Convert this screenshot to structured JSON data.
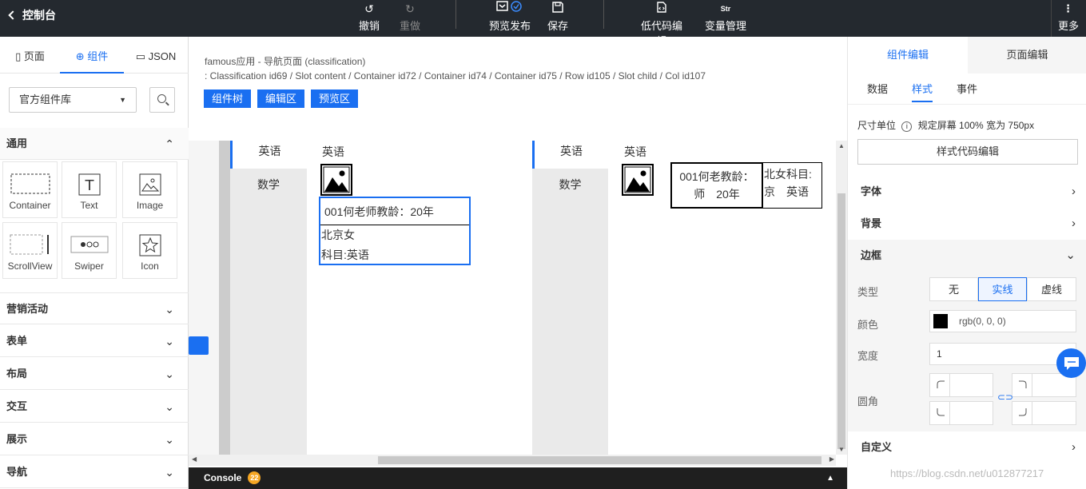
{
  "topbar": {
    "back_label": "控制台",
    "undo": "撤销",
    "redo": "重做",
    "preview": "预览发布",
    "save": "保存",
    "lowcode": "低代码编辑",
    "variables": "变量管理",
    "variables_icon_text": "Str",
    "more": "更多"
  },
  "left": {
    "tabs": [
      {
        "label": "页面"
      },
      {
        "label": "组件"
      },
      {
        "label": "JSON"
      }
    ],
    "library": "官方组件库",
    "general": "通用",
    "components": [
      {
        "label": "Container"
      },
      {
        "label": "Text"
      },
      {
        "label": "Image"
      },
      {
        "label": "ScrollView"
      },
      {
        "label": "Swiper"
      },
      {
        "label": "Icon"
      }
    ],
    "text_icon_glyph": "T",
    "sections": [
      {
        "label": "营销活动"
      },
      {
        "label": "表单"
      },
      {
        "label": "布局"
      },
      {
        "label": "交互"
      },
      {
        "label": "展示"
      },
      {
        "label": "导航"
      }
    ]
  },
  "center": {
    "breadcrumb1": "famous应用 - 导航页面 (classification)",
    "breadcrumb2": ": Classification id69 / Slot content / Container id72 / Container id74 / Container id75 / Row id105 / Slot child / Col id107",
    "buttons": [
      {
        "label": "组件树"
      },
      {
        "label": "编辑区"
      },
      {
        "label": "预览区"
      }
    ],
    "console_label": "Console",
    "console_count": "22",
    "canvas": {
      "left_panel": {
        "nav_items": [
          "英语",
          "数学"
        ],
        "header": "英语",
        "card_line1": "001何老师教龄：20年",
        "card_line2": "北京女",
        "card_line3": "科目:英语"
      },
      "right_panel": {
        "nav_items": [
          "英语",
          "数学"
        ],
        "header": "英语",
        "cell1_line1": "001何老教龄：",
        "cell1_line2": "师　20年",
        "cell2_line1": "北女科目:",
        "cell2_line2": "京　英语"
      }
    }
  },
  "right": {
    "tabs": [
      {
        "label": "组件编辑"
      },
      {
        "label": "页面编辑"
      }
    ],
    "subtabs": [
      {
        "label": "数据"
      },
      {
        "label": "样式"
      },
      {
        "label": "事件"
      }
    ],
    "unit_label": "尺寸单位",
    "unit_value": "规定屏幕 100% 宽为 750px",
    "style_code_button": "样式代码编辑",
    "font_section": "字体",
    "background_section": "背景",
    "border_section": "边框",
    "type_label": "类型",
    "type_options": [
      {
        "label": "无"
      },
      {
        "label": "实线"
      },
      {
        "label": "虚线"
      }
    ],
    "color_label": "颜色",
    "color_value": "rgb(0, 0, 0)",
    "width_label": "宽度",
    "width_value": "1",
    "radius_label": "圆角",
    "custom_section": "自定义"
  },
  "watermark": "https://blog.csdn.net/u012877217",
  "colors": {
    "accent": "#1a6ff1",
    "topbar": "#24292f",
    "console_badge": "#f5a623"
  }
}
